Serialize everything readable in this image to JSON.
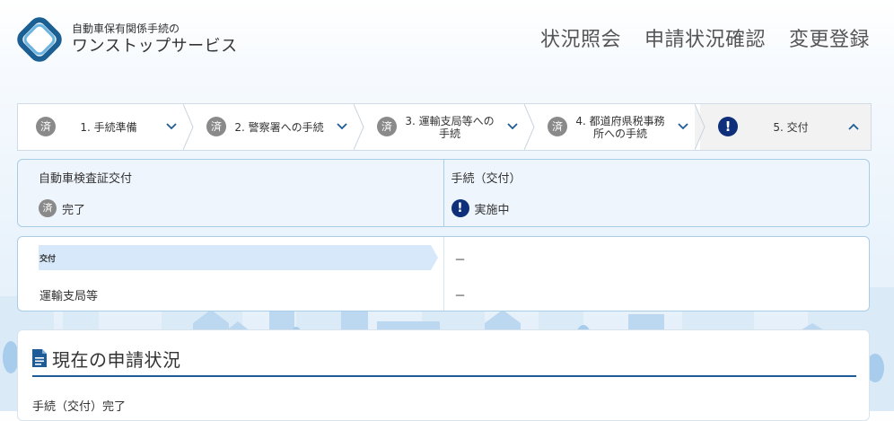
{
  "header": {
    "logo_small": "自動車保有関係手続の",
    "logo_big": "ワンストップサービス",
    "nav": [
      {
        "label": "状況照会"
      },
      {
        "label": "申請状況確認"
      },
      {
        "label": "変更登録"
      }
    ]
  },
  "colors": {
    "accent": "#1f5c97",
    "done_badge": "#8a8a8a",
    "alert_badge": "#0f2f7a",
    "card_border": "#a9cde6"
  },
  "stepper": {
    "steps": [
      {
        "badge": "済",
        "label": "1. 手続準備",
        "state": "done",
        "chevron": "chevron-down"
      },
      {
        "badge": "済",
        "label": "2. 警察署への手続",
        "state": "done",
        "chevron": "chevron-down"
      },
      {
        "badge": "済",
        "label": "3. 運輸支局等への手続",
        "state": "done",
        "chevron": "chevron-down"
      },
      {
        "badge": "済",
        "label": "4. 都道府県税事務所への手続",
        "state": "done",
        "chevron": "chevron-down"
      },
      {
        "badge": "!",
        "label": "5. 交付",
        "state": "in-progress",
        "chevron": "chevron-up"
      }
    ]
  },
  "status": {
    "left_title": "自動車検査証交付",
    "left_badge": "済",
    "left_value": "完了",
    "right_title": "手続（交付）",
    "right_badge": "!",
    "right_value": "実施中"
  },
  "detail": {
    "row1_label": "交付",
    "row1_value": "－",
    "row2_label": "運輸支局等",
    "row2_value": "－"
  },
  "current": {
    "title": "現在の申請状況",
    "text": "手続（交付）完了"
  }
}
